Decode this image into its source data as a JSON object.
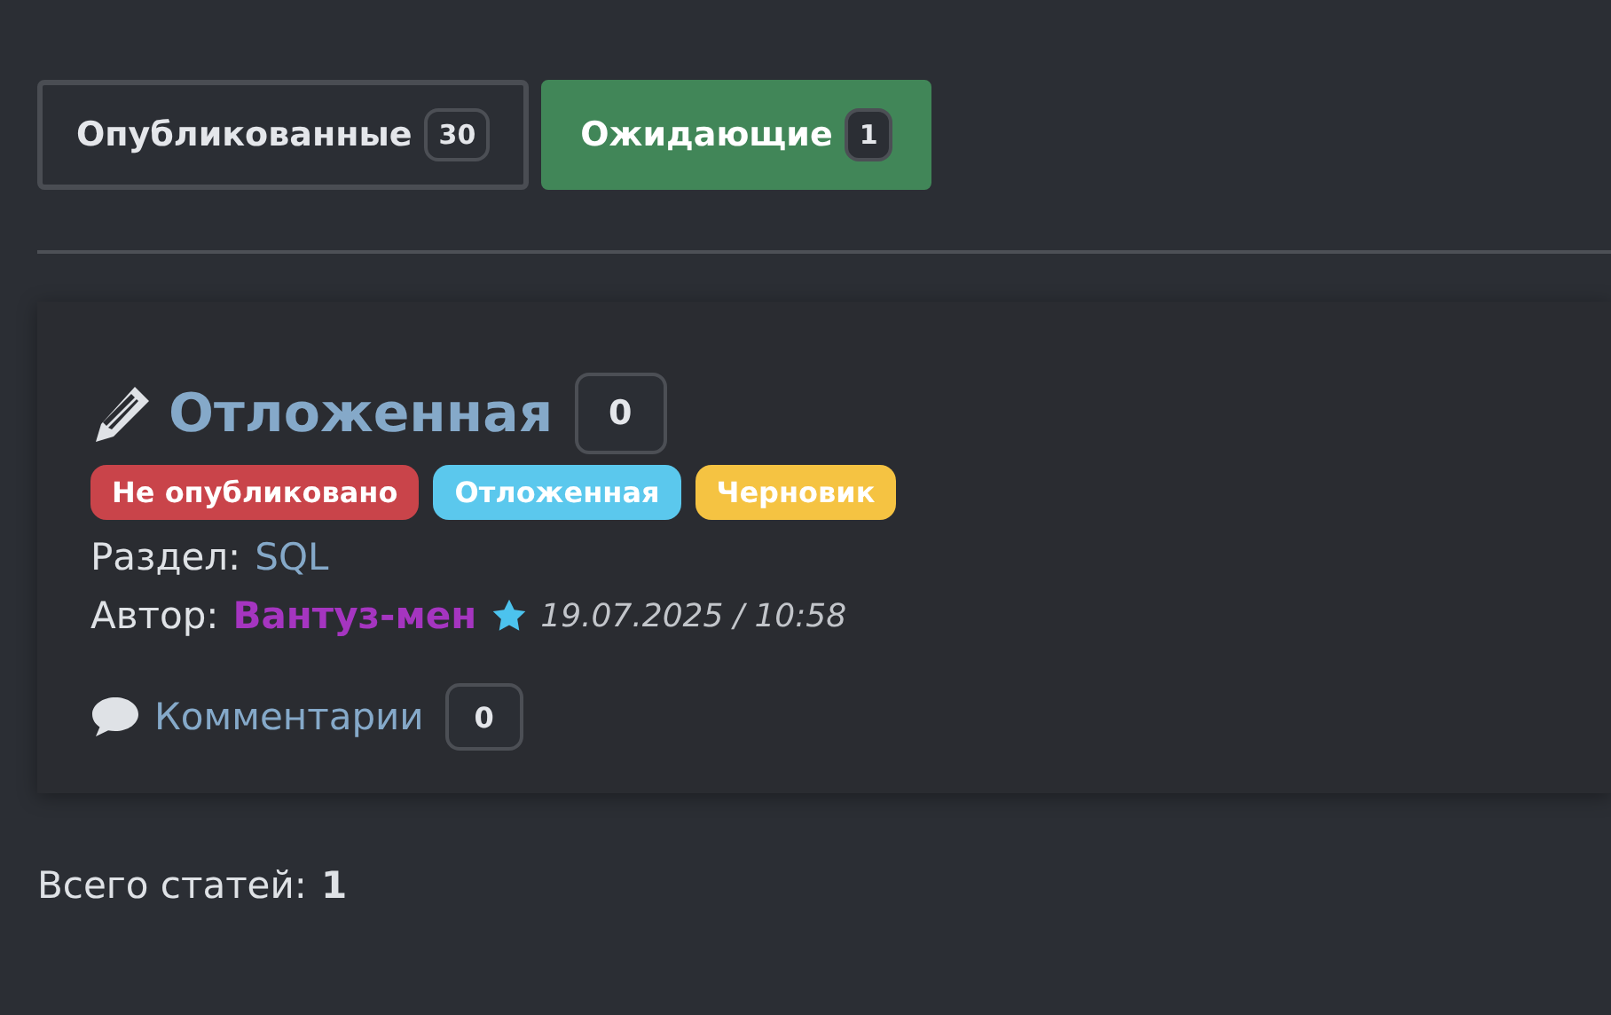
{
  "tabs": [
    {
      "label": "Опубликованные",
      "count": "30",
      "selected": false
    },
    {
      "label": "Ожидающие",
      "count": "1",
      "selected": true
    }
  ],
  "article": {
    "title": "Отложенная",
    "count": "0",
    "tags": [
      {
        "label": "Не опубликовано",
        "color": "#c9444a"
      },
      {
        "label": "Отложенная",
        "color": "#5bc8ed"
      },
      {
        "label": "Черновик",
        "color": "#f5c342"
      }
    ],
    "section_label": "Раздел:",
    "section": "SQL",
    "author_label": "Автор:",
    "author": "Вантуз-мен",
    "datetime": "19.07.2025 / 10:58",
    "comments_label": "Комментарии",
    "comments_count": "0"
  },
  "total": {
    "label": "Всего статей:",
    "value": "1"
  }
}
